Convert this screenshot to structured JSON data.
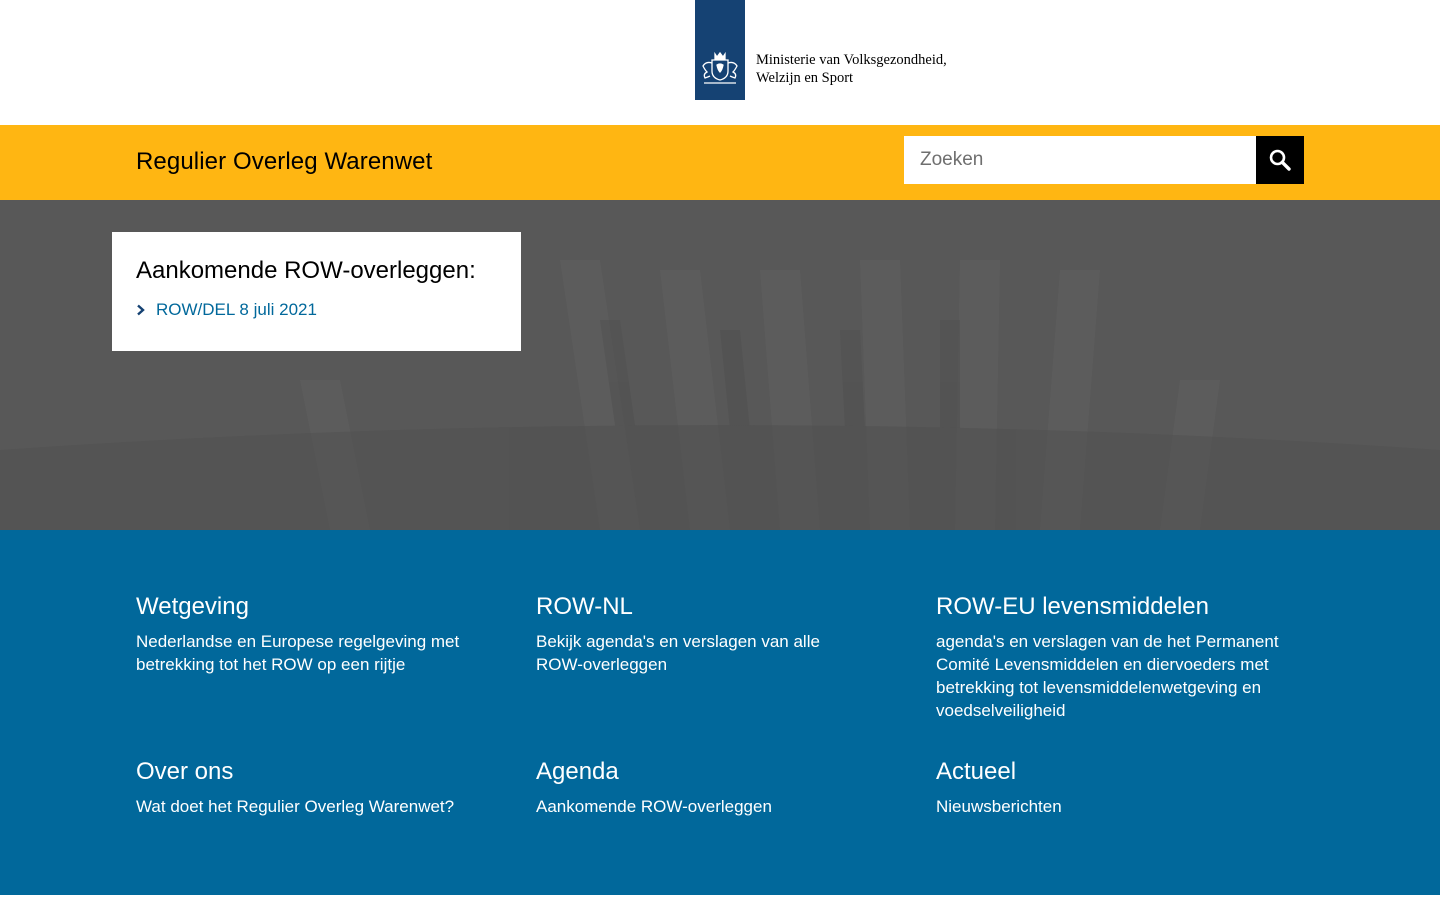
{
  "header": {
    "ministry_name_line1": "Ministerie van Volksgezondheid,",
    "ministry_name_line2": "Welzijn en Sport",
    "logo_icon": "rijksoverheid-crest-icon",
    "brand_color": "#154273"
  },
  "title_bar": {
    "site_title": "Regulier Overleg Warenwet",
    "background_color": "#ffb612",
    "search": {
      "placeholder": "Zoeken",
      "value": "",
      "button_icon": "search-icon"
    }
  },
  "hero": {
    "card": {
      "heading": "Aankomende ROW-overleggen:",
      "items": [
        {
          "label": "ROW/DEL 8 juli 2021",
          "icon": "chevron-right-icon"
        }
      ]
    }
  },
  "navigation": {
    "background_color": "#01689b",
    "tiles": [
      {
        "title": "Wetgeving",
        "description": "Nederlandse en Europese regelgeving met betrekking tot het ROW op een rijtje"
      },
      {
        "title": "ROW-NL",
        "description": "Bekijk agenda's en verslagen van alle ROW-overleggen"
      },
      {
        "title": "ROW-EU levensmiddelen",
        "description": "agenda's en verslagen van de het Permanent Comité Levensmiddelen en diervoeders met betrekking tot levensmiddelenwetgeving en voedselveiligheid"
      },
      {
        "title": "Over ons",
        "description": "Wat doet het Regulier Overleg Warenwet?"
      },
      {
        "title": "Agenda",
        "description": "Aankomende ROW-overleggen"
      },
      {
        "title": "Actueel",
        "description": "Nieuwsberichten"
      }
    ]
  }
}
